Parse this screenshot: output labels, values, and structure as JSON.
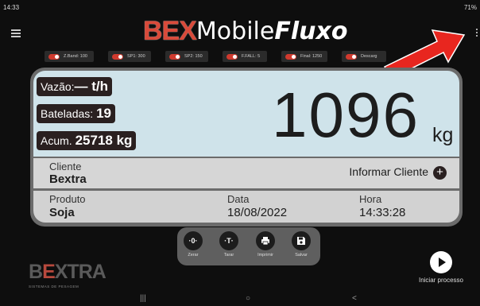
{
  "status_bar": {
    "time": "14:33",
    "right": "71%"
  },
  "header": {
    "logo_bex": "BEX",
    "logo_mobile": "Mobile",
    "logo_fluxo": "Fluxo"
  },
  "chips": [
    {
      "label": "Z.Band: 100"
    },
    {
      "label": "SP1: 300"
    },
    {
      "label": "SP2: 150"
    },
    {
      "label": "F.FALL: 5"
    },
    {
      "label": "Final: 1250"
    },
    {
      "label": "Descarg"
    }
  ],
  "display": {
    "vazao_label": "Vazão:",
    "vazao_value": "— t/h",
    "bateladas_label": "Bateladas:",
    "bateladas_value": "19",
    "acum_label": "Acum.",
    "acum_value": "25718 kg",
    "weight": "1096",
    "unit": "kg"
  },
  "cliente": {
    "label": "Cliente",
    "value": "Bextra",
    "action": "Informar Cliente",
    "action_icon": "+"
  },
  "info": {
    "produto_label": "Produto",
    "produto_value": "Soja",
    "data_label": "Data",
    "data_value": "18/08/2022",
    "hora_label": "Hora",
    "hora_value": "14:33:28"
  },
  "toolbar": [
    {
      "glyph": "·0·",
      "label": "Zerar"
    },
    {
      "glyph": "·T·",
      "label": "Tarar"
    },
    {
      "glyph": "",
      "label": "Imprimir"
    },
    {
      "glyph": "",
      "label": "Salvar"
    }
  ],
  "brand": {
    "name_a": "B",
    "name_b": "E",
    "name_c": "XTRA",
    "tagline": "SISTEMAS DE PESAGEM"
  },
  "start": {
    "label": "Iniciar processo"
  },
  "nav": {
    "recent": "|||",
    "home": "○",
    "back": "<"
  }
}
